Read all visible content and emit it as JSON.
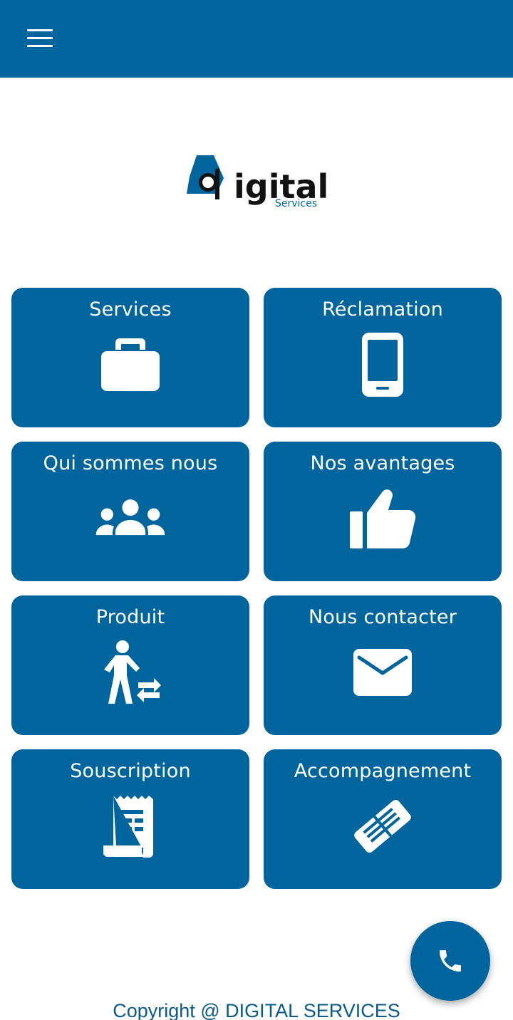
{
  "header": {
    "menu_icon": "hamburger-menu-icon",
    "bg_color": "#00659c"
  },
  "logo": {
    "text_main": "igital",
    "text_sub": "Services"
  },
  "tiles": [
    {
      "label": "Services",
      "icon": "briefcase-icon"
    },
    {
      "label": "Réclamation",
      "icon": "smartphone-icon"
    },
    {
      "label": "Qui sommes nous",
      "icon": "group-icon"
    },
    {
      "label": "Nos avantages",
      "icon": "thumbs-up-icon"
    },
    {
      "label": "Produit",
      "icon": "person-exchange-icon"
    },
    {
      "label": "Nous contacter",
      "icon": "envelope-icon"
    },
    {
      "label": "Souscription",
      "icon": "receipt-icon"
    },
    {
      "label": "Accompagnement",
      "icon": "handshake-icon"
    }
  ],
  "fab": {
    "icon": "phone-icon"
  },
  "footer": {
    "copyright": "Copyright @ DIGITAL SERVICES"
  },
  "colors": {
    "primary": "#00659c",
    "white": "#ffffff",
    "footer_text": "#0a5a8a"
  }
}
